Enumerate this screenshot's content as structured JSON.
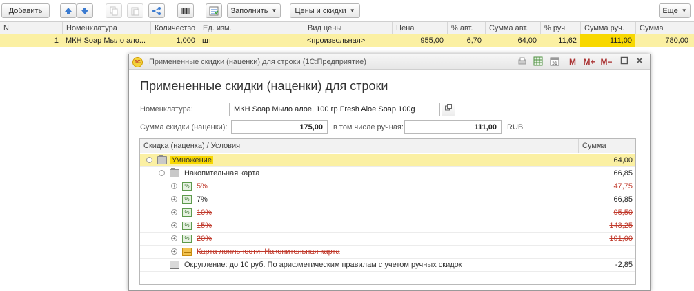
{
  "toolbar": {
    "add_label": "Добавить",
    "fill_label": "Заполнить",
    "prices_label": "Цены и скидки",
    "more_label": "Еще"
  },
  "grid": {
    "columns": [
      "N",
      "Номенклатура",
      "Количество",
      "Ед. изм.",
      "Вид цены",
      "Цена",
      "% авт.",
      "Сумма авт.",
      "% руч.",
      "Сумма руч.",
      "Сумма"
    ],
    "rows": [
      {
        "n": "1",
        "item": "МКН Soap Мыло ало...",
        "qty": "1,000",
        "unit": "шт",
        "price_type": "<произвольная>",
        "price": "955,00",
        "auto_pct": "6,70",
        "auto_sum": "64,00",
        "manual_pct": "11,62",
        "manual_sum": "111,00",
        "sum": "780,00"
      }
    ]
  },
  "dialog": {
    "window_title": "Примененные скидки (наценки) для строки (1С:Предприятие)",
    "app_logo": "1С",
    "title_buttons": {
      "m": "M",
      "m_plus": "M+",
      "m_minus": "M−"
    },
    "heading": "Примененные скидки (наценки) для строки",
    "nomenclature_label": "Номенклатура:",
    "nomenclature_value": "МКН Soap Мыло алое, 100 гр Fresh Aloe Soap 100g",
    "discount_sum_label": "Сумма скидки (наценки):",
    "discount_sum_value": "175,00",
    "manual_label": "в том числе ручная:",
    "manual_value": "111,00",
    "currency": "RUB",
    "tree_headers": {
      "name": "Скидка (наценка) / Условия",
      "sum": "Сумма"
    },
    "tree_rows": [
      {
        "text": "Умножение",
        "sum": "64,00"
      },
      {
        "text": "Накопительная карта",
        "sum": "66,85"
      },
      {
        "text": "5%",
        "sum": "47,75"
      },
      {
        "text": "7%",
        "sum": "66,85"
      },
      {
        "text": "10%",
        "sum": "95,50"
      },
      {
        "text": "15%",
        "sum": "143,25"
      },
      {
        "text": "20%",
        "sum": "191,00"
      },
      {
        "text": "Карта лояльности: Накопительная карта",
        "sum": ""
      },
      {
        "text": "Округление: до 10 руб. По арифметическим правилам с учетом ручных скидок",
        "sum": "-2,85"
      }
    ]
  },
  "colors": {
    "selection_row": "#fbf0a3",
    "highlight_cell": "#f8d800",
    "strike_text": "#c0392b"
  }
}
